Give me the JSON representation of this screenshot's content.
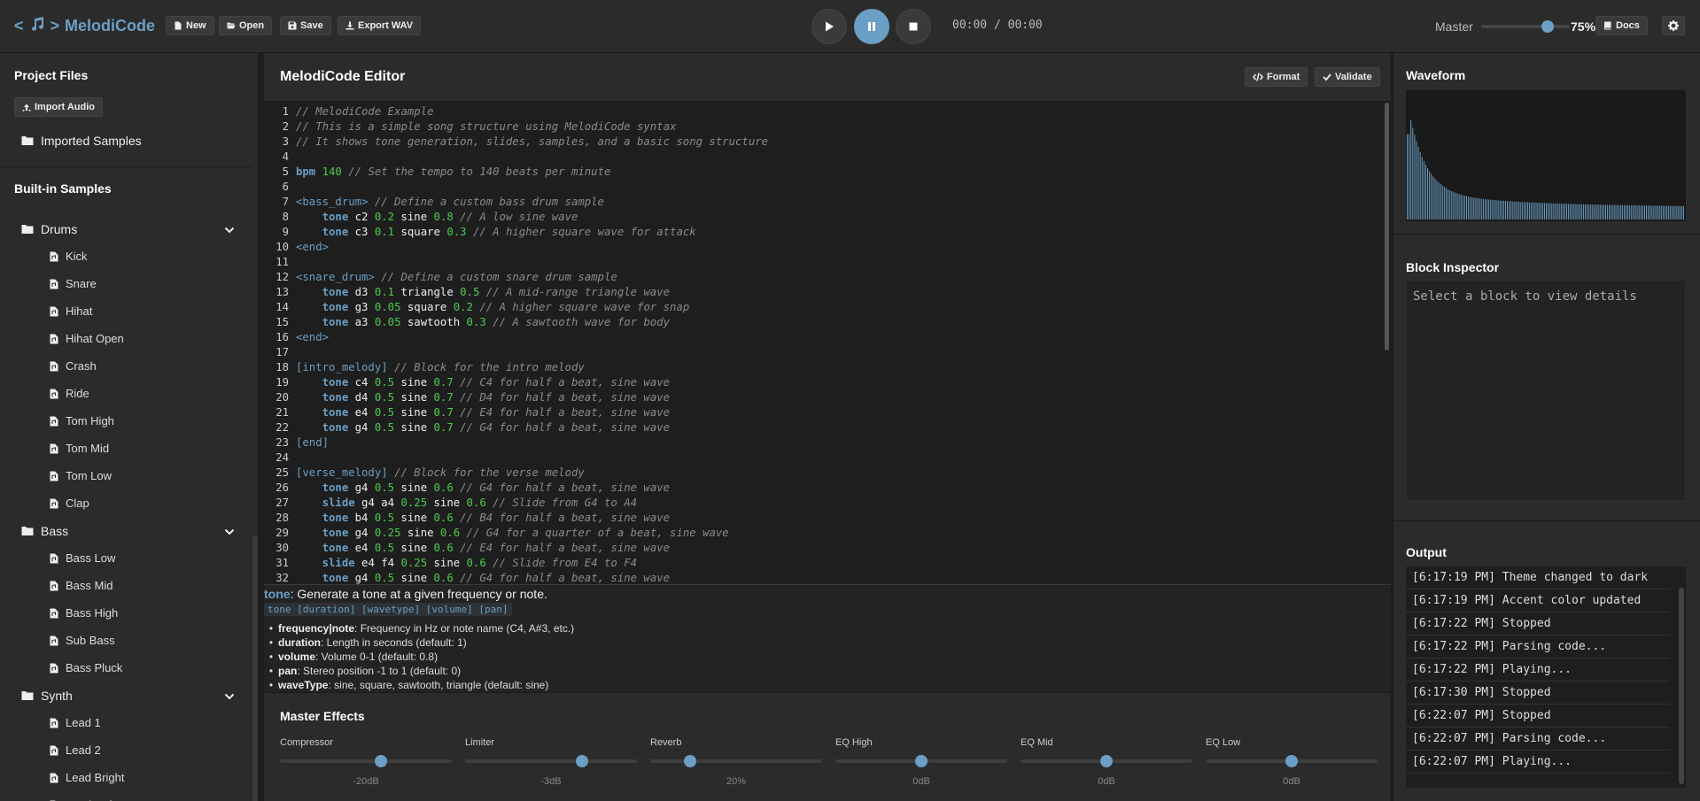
{
  "app": {
    "title": "MelodiCode",
    "left_sym": "<",
    "right_sym": ">"
  },
  "toolbar": {
    "new_label": "New",
    "open_label": "Open",
    "save_label": "Save",
    "export_label": "Export WAV"
  },
  "transport": {
    "time": "00:00 / 00:00"
  },
  "master": {
    "label": "Master",
    "volume_text": "75%",
    "volume_fraction": 0.75,
    "docs_label": "Docs"
  },
  "sidebar": {
    "project_files_title": "Project Files",
    "import_label": "Import Audio",
    "imported_folder": "Imported Samples",
    "builtin_title": "Built-in Samples",
    "groups": [
      {
        "name": "Drums",
        "items": [
          "Kick",
          "Snare",
          "Hihat",
          "Hihat Open",
          "Crash",
          "Ride",
          "Tom High",
          "Tom Mid",
          "Tom Low",
          "Clap"
        ]
      },
      {
        "name": "Bass",
        "items": [
          "Bass Low",
          "Bass Mid",
          "Bass High",
          "Sub Bass",
          "Bass Pluck"
        ]
      },
      {
        "name": "Synth",
        "items": [
          "Lead 1",
          "Lead 2",
          "Lead Bright",
          "Lead Soft"
        ]
      }
    ]
  },
  "editor": {
    "title": "MelodiCode Editor",
    "format_label": "Format",
    "validate_label": "Validate",
    "code": [
      "// MelodiCode Example",
      "// This is a simple song structure using MelodiCode syntax",
      "// It shows tone generation, slides, samples, and a basic song structure",
      "",
      "bpm 140 // Set the tempo to 140 beats per minute",
      "",
      "<bass_drum> // Define a custom bass drum sample",
      "    tone c2 0.2 sine 0.8 // A low sine wave",
      "    tone c3 0.1 square 0.3 // A higher square wave for attack",
      "<end>",
      "",
      "<snare_drum> // Define a custom snare drum sample",
      "    tone d3 0.1 triangle 0.5 // A mid-range triangle wave",
      "    tone g3 0.05 square 0.2 // A higher square wave for snap",
      "    tone a3 0.05 sawtooth 0.3 // A sawtooth wave for body",
      "<end>",
      "",
      "[intro_melody] // Block for the intro melody",
      "    tone c4 0.5 sine 0.7 // C4 for half a beat, sine wave",
      "    tone d4 0.5 sine 0.7 // D4 for half a beat, sine wave",
      "    tone e4 0.5 sine 0.7 // E4 for half a beat, sine wave",
      "    tone g4 0.5 sine 0.7 // G4 for half a beat, sine wave",
      "[end]",
      "",
      "[verse_melody] // Block for the verse melody",
      "    tone g4 0.5 sine 0.6 // G4 for half a beat, sine wave",
      "    slide g4 a4 0.25 sine 0.6 // Slide from G4 to A4",
      "    tone b4 0.5 sine 0.6 // B4 for half a beat, sine wave",
      "    tone g4 0.25 sine 0.6 // G4 for a quarter of a beat, sine wave",
      "    tone e4 0.5 sine 0.6 // E4 for half a beat, sine wave",
      "    slide e4 f4 0.25 sine 0.6 // Slide from E4 to F4",
      "    tone g4 0.5 sine 0.6 // G4 for half a beat, sine wave"
    ]
  },
  "help": {
    "keyword": "tone",
    "description": ": Generate a tone at a given frequency or note.",
    "signature": "tone [duration] [wavetype] [volume] [pan]",
    "params": [
      {
        "name": "frequency|note",
        "desc": ": Frequency in Hz or note name (C4, A#3, etc.)"
      },
      {
        "name": "duration",
        "desc": ": Length in seconds (default: 1)"
      },
      {
        "name": "volume",
        "desc": ": Volume 0-1 (default: 0.8)"
      },
      {
        "name": "pan",
        "desc": ": Stereo position -1 to 1 (default: 0)"
      },
      {
        "name": "waveType",
        "desc": ": sine, square, sawtooth, triangle (default: sine)"
      }
    ]
  },
  "effects": {
    "title": "Master Effects",
    "controls": [
      {
        "label": "Compressor",
        "value": "-20dB",
        "level": 0.59
      },
      {
        "label": "Limiter",
        "value": "-3dB",
        "level": 0.68
      },
      {
        "label": "Reverb",
        "value": "20%",
        "level": 0.23
      },
      {
        "label": "EQ High",
        "value": "0dB",
        "level": 0.5
      },
      {
        "label": "EQ Mid",
        "value": "0dB",
        "level": 0.5
      },
      {
        "label": "EQ Low",
        "value": "0dB",
        "level": 0.5
      }
    ]
  },
  "right": {
    "waveform_title": "Waveform",
    "inspector_title": "Block Inspector",
    "inspector_placeholder": "Select a block to view details",
    "output_title": "Output",
    "logs": [
      "[6:17:19 PM] Theme changed to dark",
      "[6:17:19 PM] Accent color updated",
      "[6:17:22 PM] Stopped",
      "[6:17:22 PM] Parsing code...",
      "[6:17:22 PM] Playing...",
      "[6:17:30 PM] Stopped",
      "[6:22:07 PM] Stopped",
      "[6:22:07 PM] Parsing code...",
      "[6:22:07 PM] Playing..."
    ]
  },
  "colors": {
    "accent": "#6b9fc5",
    "number": "#4ec94e",
    "bg": "#1e1e1e",
    "panel": "#2b2b2b"
  },
  "icons": [
    "music-note-icon",
    "file-icon",
    "folder-open-icon",
    "save-icon",
    "download-icon",
    "play-icon",
    "pause-icon",
    "stop-icon",
    "book-icon",
    "gear-icon",
    "upload-icon",
    "folder-icon",
    "chevron-down-icon",
    "code-icon",
    "check-icon"
  ]
}
